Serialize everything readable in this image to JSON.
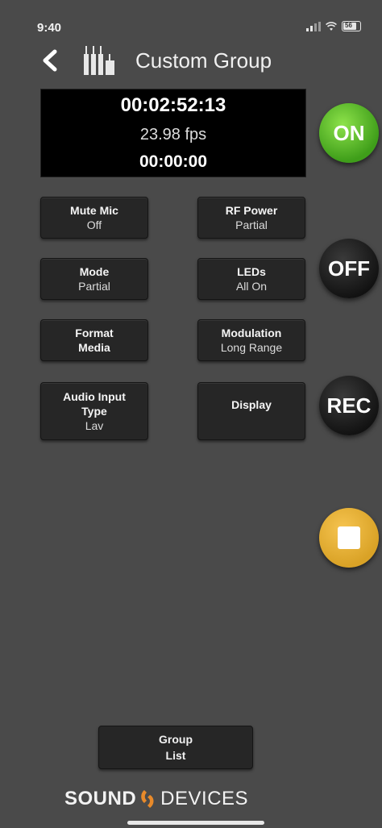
{
  "status_bar": {
    "time": "9:40",
    "battery": "56"
  },
  "nav": {
    "title": "Custom Group",
    "back_icon": "chevron-left-icon",
    "group_icon": "transmitters-group-icon"
  },
  "timecode": {
    "main": "00:02:52:13",
    "fps": "23.98 fps",
    "secondary": "00:00:00"
  },
  "tiles": [
    {
      "line1": "Mute Mic",
      "line2": "Off"
    },
    {
      "line1": "RF Power",
      "line2": "Partial"
    },
    {
      "line1": "Mode",
      "line2": "Partial"
    },
    {
      "line1": "LEDs",
      "line2": "All On"
    },
    {
      "line1": "Format",
      "line2": "Media"
    },
    {
      "line1": "Modulation",
      "line2": "Long Range"
    },
    {
      "line1": "Audio Input",
      "line2": "Type",
      "line3": "Lav"
    },
    {
      "line1": "Display"
    }
  ],
  "controls": {
    "on_label": "ON",
    "off_label": "OFF",
    "rec_label": "REC",
    "stop_icon": "stop-icon"
  },
  "colors": {
    "on": "#4caf22",
    "stop": "#e8b23a",
    "background": "#4a4a4a"
  },
  "footer": {
    "group_list_label": "Group List",
    "logo_left": "SOUND",
    "logo_right": "DEVICES"
  }
}
